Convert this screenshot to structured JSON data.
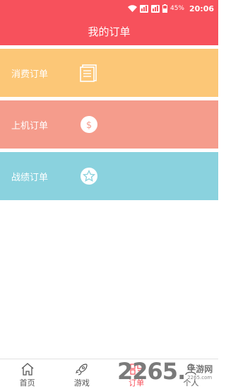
{
  "status_bar": {
    "battery": "45%",
    "time": "20:06",
    "icons": [
      "wifi-icon",
      "sim1-signal-icon",
      "sim2-signal-icon",
      "battery-icon"
    ]
  },
  "header": {
    "title": "我的订单"
  },
  "cards": [
    {
      "label": "消费订单",
      "icon": "document-list-icon",
      "color": "#fcc777"
    },
    {
      "label": "上机订单",
      "icon": "dollar-coin-icon",
      "color": "#f59c8c"
    },
    {
      "label": "战绩订单",
      "icon": "star-badge-icon",
      "color": "#8ad2de"
    }
  ],
  "tabbar": {
    "items": [
      {
        "label": "首页",
        "icon": "home-icon",
        "active": false
      },
      {
        "label": "游戏",
        "icon": "rocket-icon",
        "active": false
      },
      {
        "label": "订单",
        "icon": "order-grid-icon",
        "active": true
      },
      {
        "label": "个人",
        "icon": "person-icon",
        "active": false
      }
    ],
    "active_color": "#f7515c"
  },
  "watermark": {
    "number": "2265",
    "suffix": ".",
    "site_name": "手游网",
    "url": "2265.com"
  },
  "colors": {
    "primary": "#f7515c"
  }
}
